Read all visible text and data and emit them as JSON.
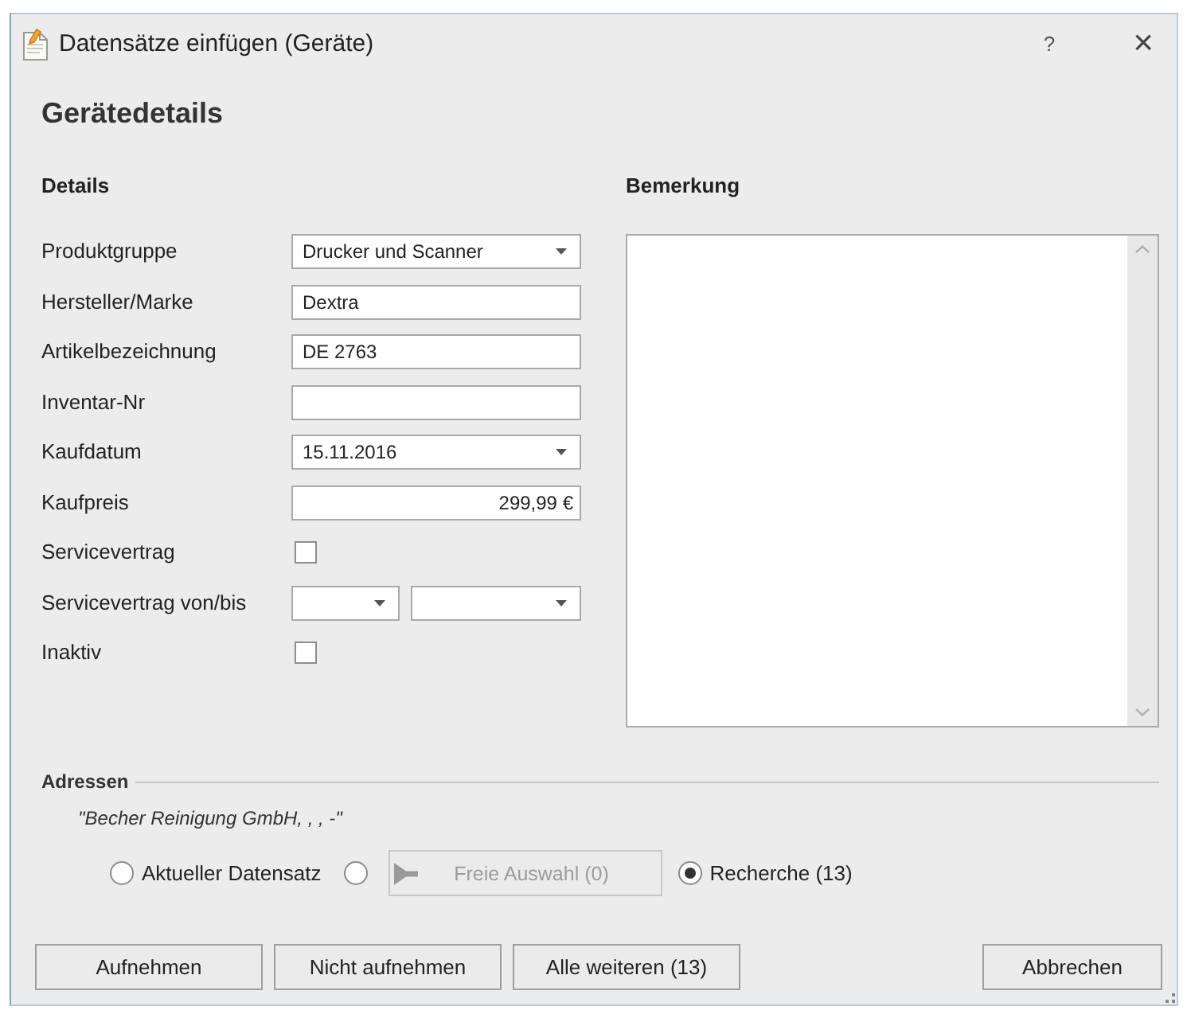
{
  "window": {
    "title": "Datensätze einfügen (Geräte)",
    "help": "?",
    "close": "×"
  },
  "heading": "Gerätedetails",
  "details": {
    "title": "Details",
    "fields": [
      {
        "label": "Produktgruppe",
        "kind": "combo",
        "value": "Drucker und Scanner"
      },
      {
        "label": "Hersteller/Marke",
        "kind": "text",
        "value": "Dextra"
      },
      {
        "label": "Artikelbezeichnung",
        "kind": "text",
        "value": "DE 2763"
      },
      {
        "label": "Inventar-Nr",
        "kind": "text"
      },
      {
        "label": "Kaufdatum",
        "kind": "combo",
        "value": "15.11.2016"
      },
      {
        "label": "Kaufpreis",
        "kind": "amount",
        "value": "299,99 €"
      },
      {
        "label": "Servicevertrag",
        "kind": "checkbox",
        "checked": false
      },
      {
        "label": "Servicevertrag von/bis",
        "kind": "combo_pair"
      },
      {
        "label": "Inaktiv",
        "kind": "checkbox",
        "checked": false
      }
    ]
  },
  "remark": {
    "title": "Bemerkung"
  },
  "addresses": {
    "title": "Adressen",
    "record": "\"Becher Reinigung GmbH, , , -\"",
    "options": [
      {
        "kind": "radio",
        "label": "Aktueller Datensatz",
        "selected": false
      },
      {
        "kind": "radio_button",
        "label": "Freie Auswahl (0)",
        "selected": false,
        "disabled": true
      },
      {
        "kind": "radio",
        "label": "Recherche (13)",
        "selected": true
      }
    ]
  },
  "buttons": [
    {
      "label": "Aufnehmen"
    },
    {
      "label": "Nicht aufnehmen"
    },
    {
      "label": "Alle weiteren (13)"
    }
  ],
  "cancel_button": "Abbrechen"
}
